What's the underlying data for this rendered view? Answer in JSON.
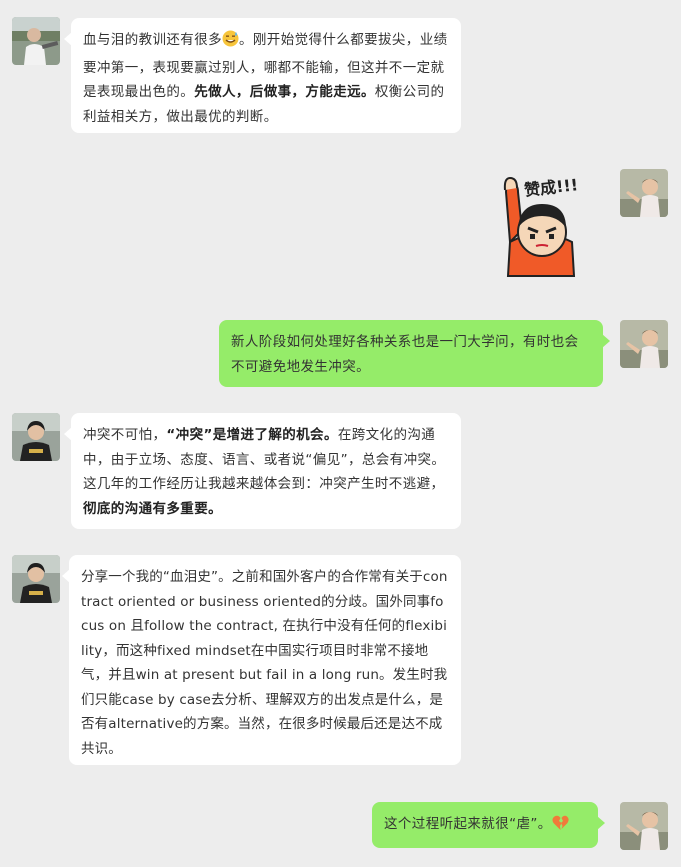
{
  "messages": [
    {
      "side": "left",
      "avatar_icon": "person-outdoor-avatar-icon",
      "segments": [
        {
          "text": "血与泪的教训还有很多"
        },
        {
          "emoji": "sweat-smile-emoji-icon"
        },
        {
          "text": "。刚开始觉得什么都要拔尖，业绩要冲第一，表现要赢过别人，哪都不能输，但这并不一定就是表现最出色的。"
        },
        {
          "text": "先做人，后做事，方能走远。",
          "bold": true
        },
        {
          "text": "权衡公司的利益相关方，做出最优的判断。"
        }
      ]
    },
    {
      "side": "right",
      "type": "sticker",
      "avatar_icon": "person-child-avatar-icon",
      "sticker_text": "赞成!!!",
      "sticker_icon": "raised-hand-cartoon-sticker-icon"
    },
    {
      "side": "right",
      "avatar_icon": "person-child-avatar-icon",
      "segments": [
        {
          "text": "新人阶段如何处理好各种关系也是一门大学问，有时也会不可避免地发生冲突。"
        }
      ]
    },
    {
      "side": "left",
      "avatar_icon": "person-hoodie-avatar-icon",
      "segments": [
        {
          "text": "冲突不可怕，"
        },
        {
          "text": "“冲突”是增进了解的机会。",
          "bold": true
        },
        {
          "text": "在跨文化的沟通中，由于立场、态度、语言、或者说“偏见”，总会有冲突。这几年的工作经历让我越来越体会到：冲突产生时不逃避，"
        },
        {
          "text": "彻底的沟通有多重要。",
          "bold": true
        }
      ]
    },
    {
      "side": "left",
      "avatar_icon": "person-hoodie-avatar-icon",
      "segments": [
        {
          "text": "分享一个我的“血泪史”。之前和国外客户的合作常有关于contract oriented or business oriented的分歧。国外同事focus on 且follow the contract, 在执行中没有任何的flexibility，而这种fixed mindset在中国实行项目时非常不接地气，并且win at present but fail in a long run。发生时我们只能case by case去分析、理解双方的出发点是什么，是否有alternative的方案。当然，在很多时候最后还是达不成共识。"
        }
      ]
    },
    {
      "side": "right",
      "avatar_icon": "person-child-avatar-icon",
      "segments": [
        {
          "text": "这个过程听起来就很“虐”。"
        },
        {
          "emoji": "broken-heart-emoji-icon"
        }
      ]
    }
  ]
}
